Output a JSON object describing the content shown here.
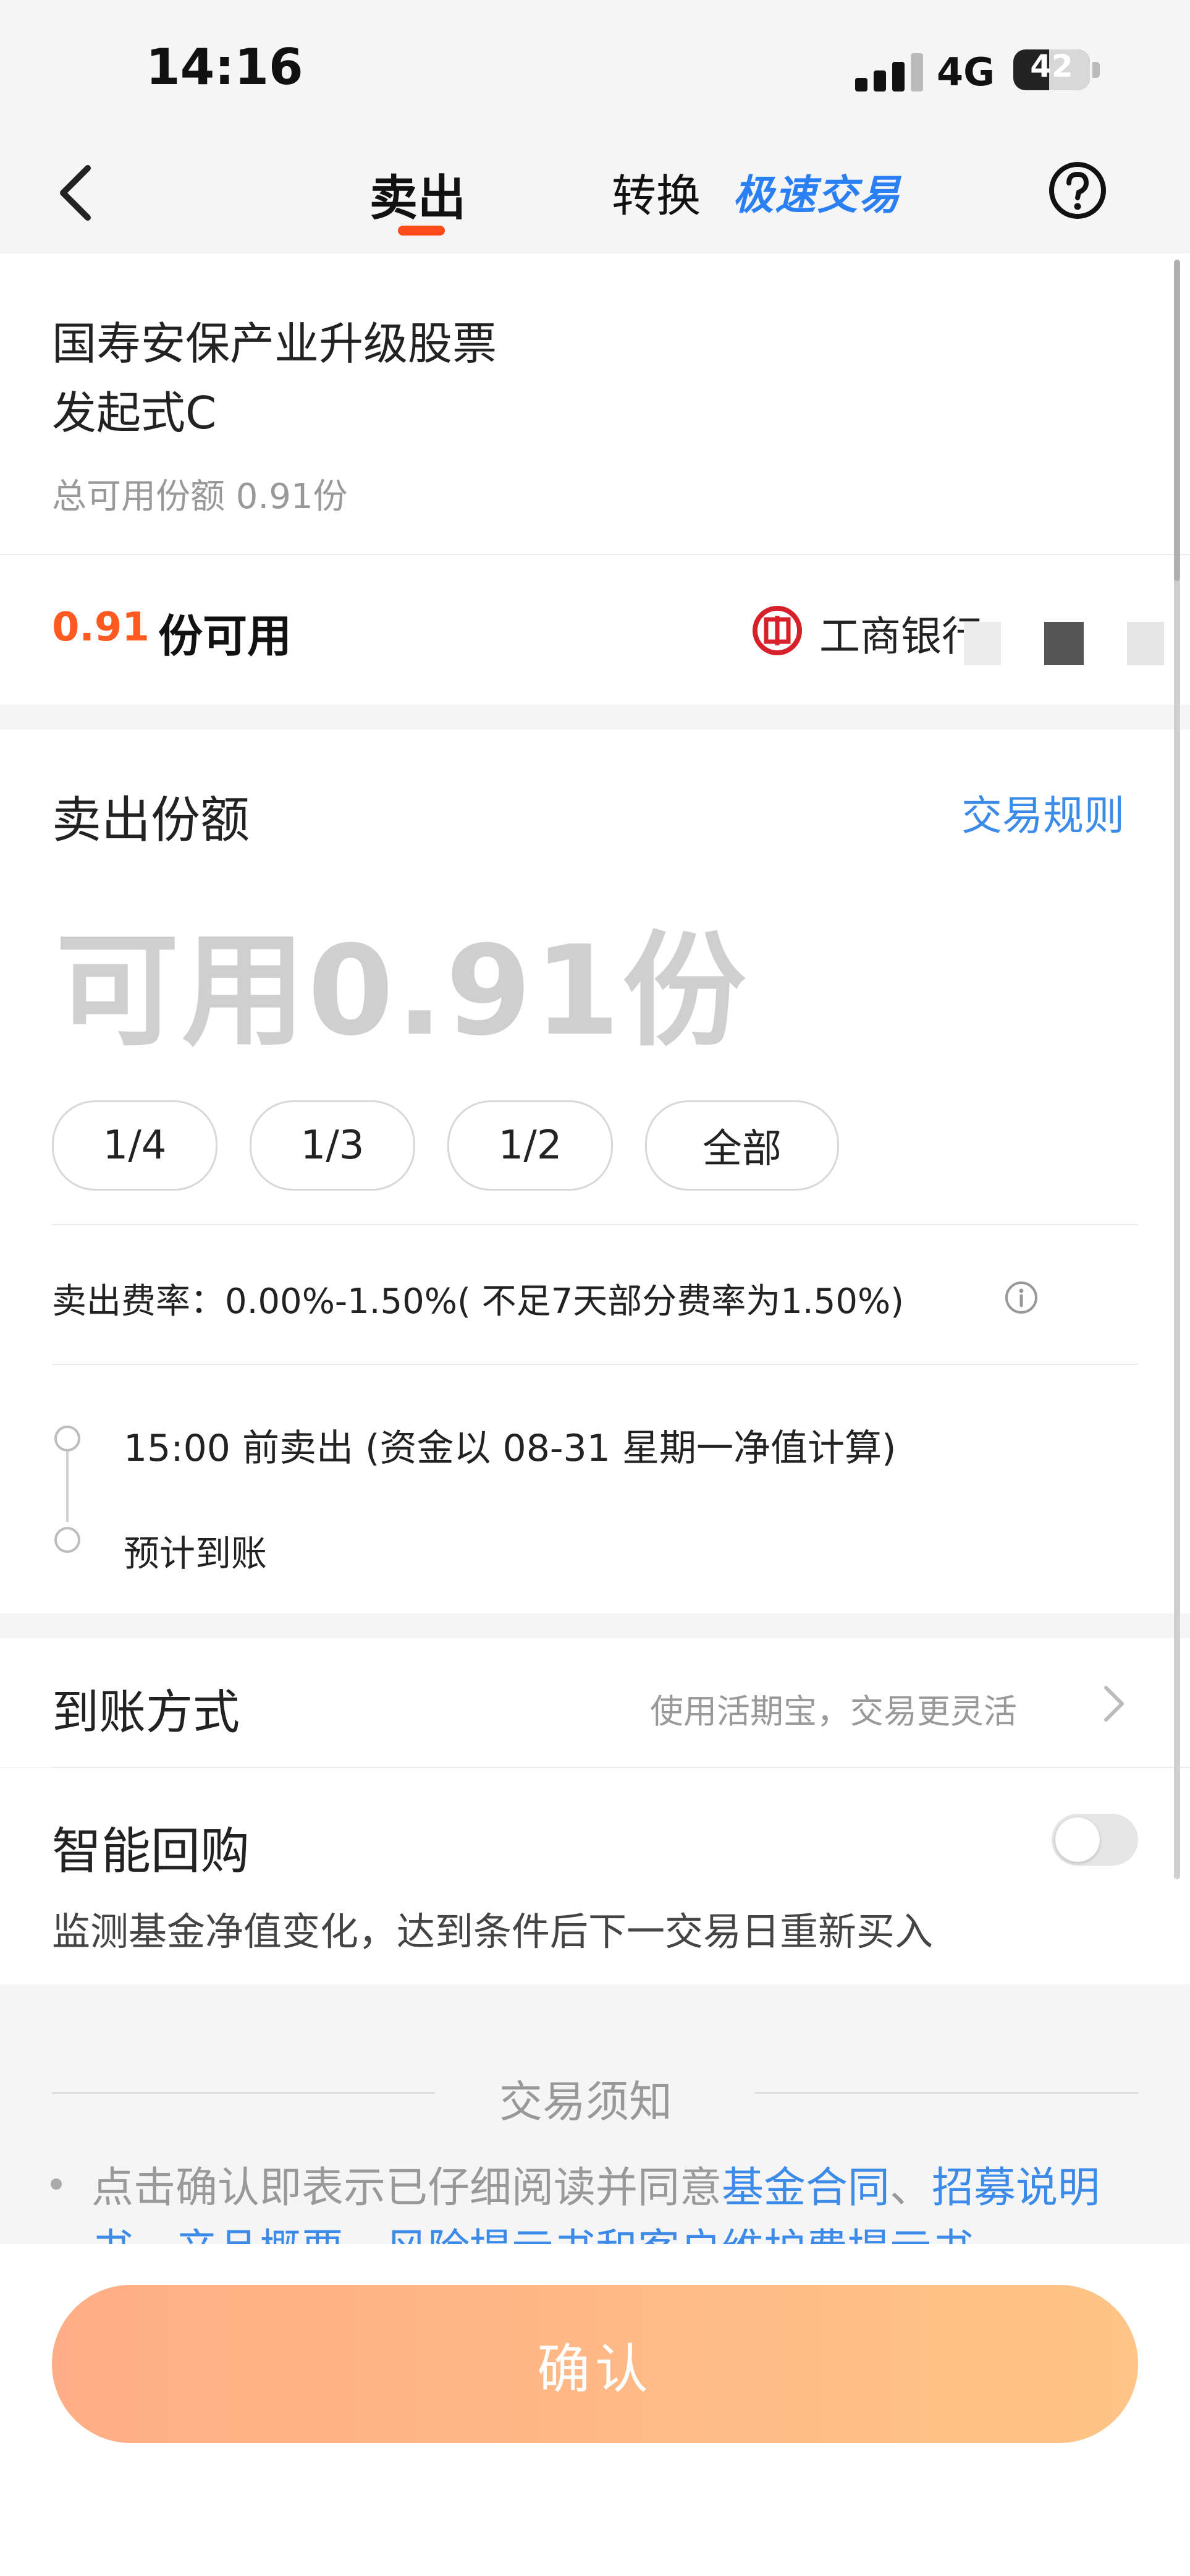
{
  "status_bar": {
    "time": "14:16",
    "network": "4G",
    "battery": "42"
  },
  "nav": {
    "tab_sell": "卖出",
    "tab_convert": "转换",
    "tab_fast": "极速交易"
  },
  "fund": {
    "name_line1": "国寿安保产业升级股票",
    "name_line2": "发起式C",
    "total_shares": "总可用份额 0.91份",
    "available_num": "0.91",
    "available_label": "份可用",
    "bank": "工商银行"
  },
  "sell": {
    "title": "卖出份额",
    "rules_link": "交易规则",
    "amount_placeholder": "可用0.91份",
    "chips": [
      "1/4",
      "1/3",
      "1/2",
      "全部"
    ],
    "fee": "卖出费率：0.00%-1.50%( 不足7天部分费率为1.50%)",
    "timeline_step1": "15:00 前卖出 (资金以 08-31 星期一净值计算)",
    "timeline_step2": "预计到账"
  },
  "arrive": {
    "label": "到账方式",
    "hint": "使用活期宝，交易更灵活"
  },
  "rebuy": {
    "label": "智能回购",
    "desc": "监测基金净值变化，达到条件后下一交易日重新买入",
    "enabled": false
  },
  "notice": {
    "title": "交易须知",
    "text_prefix": "点击确认即表示已仔细阅读并同意",
    "link1": "基金合同",
    "sep": "、",
    "link2": "招募说明书、产品概要、风险提示书和客户维护费提示书"
  },
  "confirm_label": "确认",
  "colors": {
    "accent": "#ff4a1a",
    "link": "#3c8be8",
    "button_start": "#ffad86",
    "button_end": "#ffc486"
  }
}
